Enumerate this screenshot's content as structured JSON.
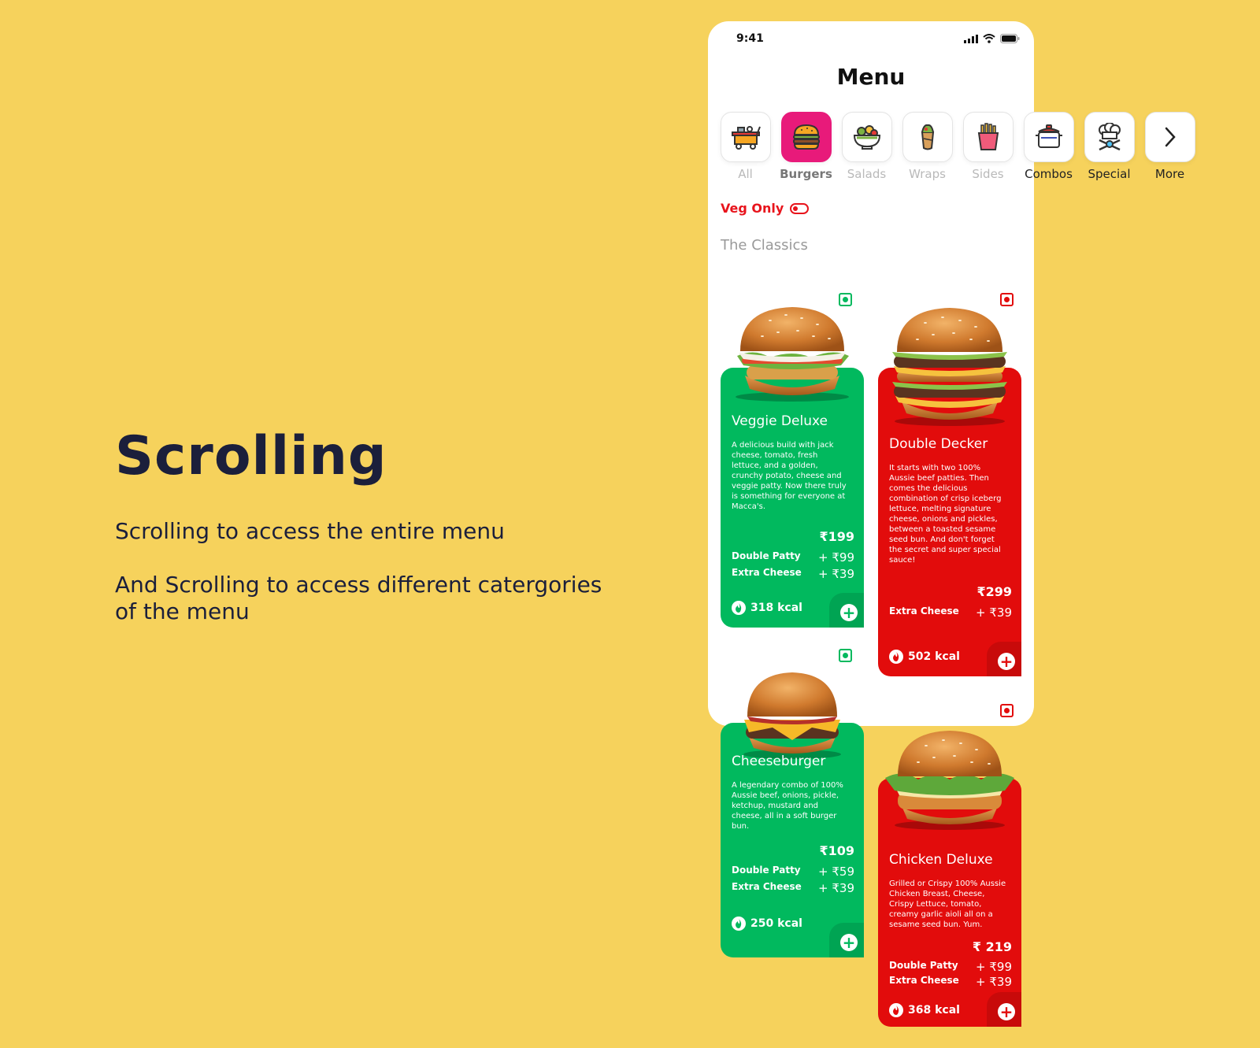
{
  "hero": {
    "title": "Scrolling",
    "subtitle1": "Scrolling to access the entire menu",
    "subtitle2": "And Scrolling to access different catergories of the menu"
  },
  "status_bar": {
    "time": "9:41"
  },
  "header": {
    "title": "Menu"
  },
  "categories": [
    {
      "label": "All",
      "icon": "food-cart-icon",
      "active": false
    },
    {
      "label": "Burgers",
      "icon": "burger-icon",
      "active": true
    },
    {
      "label": "Salads",
      "icon": "salad-bowl-icon",
      "active": false
    },
    {
      "label": "Wraps",
      "icon": "wrap-icon",
      "active": false
    },
    {
      "label": "Sides",
      "icon": "fries-icon",
      "active": false
    },
    {
      "label": "Combos",
      "icon": "pot-icon",
      "active": false
    },
    {
      "label": "Special",
      "icon": "chef-icon",
      "active": false
    },
    {
      "label": "More",
      "icon": "chevron-right-icon",
      "active": false
    }
  ],
  "filter": {
    "veg_only_label": "Veg Only"
  },
  "section": {
    "title": "The Classics"
  },
  "colors": {
    "background": "#F6D25C",
    "veg": "#01B95E",
    "nonveg": "#E20C0C",
    "active_category": "#E81A7A",
    "title": "#1B1F3B"
  },
  "cards": [
    {
      "name": "Veggie Deluxe",
      "diet": "veg",
      "description": "A delicious build with jack cheese, tomato, fresh lettuce, and a golden, crunchy potato, cheese and veggie patty. Now there truly is something for everyone at Macca's.",
      "price": "₹199",
      "addons": [
        {
          "label": "Double Patty",
          "price": "+ ₹99"
        },
        {
          "label": "Extra Cheese",
          "price": "+ ₹39"
        }
      ],
      "kcal": "318 kcal"
    },
    {
      "name": "Double Decker",
      "diet": "nonveg",
      "description": "It starts with two 100% Aussie beef patties. Then comes the delicious combination of crisp iceberg lettuce, melting signature cheese, onions and pickles, between a toasted sesame seed bun. And don't forget the secret and super special sauce!",
      "price": "₹299",
      "addons": [
        {
          "label": "Extra Cheese",
          "price": "+ ₹39"
        }
      ],
      "kcal": "502 kcal"
    },
    {
      "name": "Cheeseburger",
      "diet": "veg",
      "description": "A legendary combo of 100% Aussie beef, onions, pickle, ketchup, mustard and cheese, all in a soft burger bun.",
      "price": "₹109",
      "addons": [
        {
          "label": "Double Patty",
          "price": "+ ₹59"
        },
        {
          "label": "Extra Cheese",
          "price": "+ ₹39"
        }
      ],
      "kcal": "250 kcal"
    },
    {
      "name": "Chicken Deluxe",
      "diet": "nonveg",
      "description": "Grilled or Crispy 100% Aussie Chicken Breast, Cheese, Crispy Lettuce, tomato, creamy garlic aioli all on a sesame seed bun. Yum.",
      "price": "₹ 219",
      "addons": [
        {
          "label": "Double Patty",
          "price": "+ ₹99"
        },
        {
          "label": "Extra Cheese",
          "price": "+ ₹39"
        }
      ],
      "kcal": "368 kcal"
    }
  ]
}
